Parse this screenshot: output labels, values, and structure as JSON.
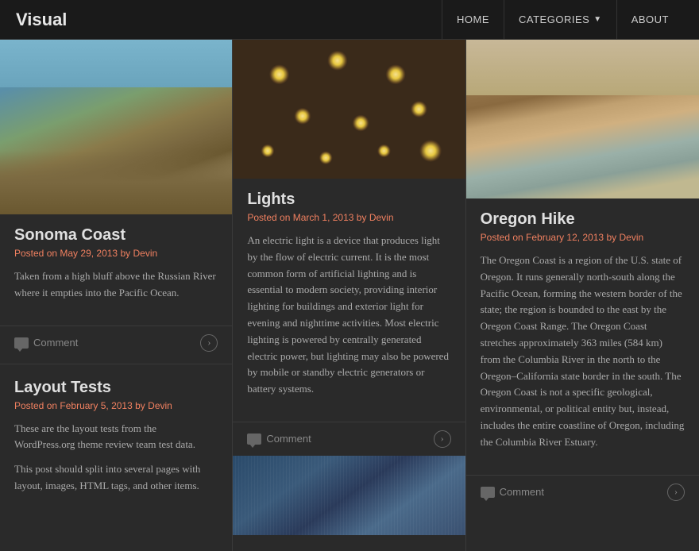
{
  "header": {
    "site_title": "Visual",
    "nav": {
      "home": "HOME",
      "categories": "CATEGORIES",
      "categories_chevron": "▼",
      "about": "ABOUT"
    }
  },
  "posts": {
    "col1": {
      "post1": {
        "title": "Sonoma Coast",
        "meta_prefix": "Posted on",
        "date": "May 29, 2013",
        "by": "by",
        "author": "Devin",
        "excerpt": "Taken from a high bluff above the Russian River where it empties into the Pacific Ocean.",
        "comment_label": "Comment"
      },
      "post2": {
        "title": "Layout Tests",
        "meta_prefix": "Posted on",
        "date": "February 5, 2013",
        "by": "by",
        "author": "Devin",
        "excerpt1": "These are the layout tests from the WordPress.org theme review team test data.",
        "excerpt2": "This post should split into several pages with layout, images, HTML tags, and other items."
      }
    },
    "col2": {
      "post1": {
        "title": "Lights",
        "meta_prefix": "Posted on",
        "date": "March 1, 2013",
        "by": "by",
        "author": "Devin",
        "excerpt": "An electric light is a device that produces light by the flow of electric current. It is the most common form of artificial lighting and is essential to modern society, providing interior lighting for buildings and exterior light for evening and nighttime activities. Most electric lighting is powered by centrally generated electric power, but lighting may also be powered by mobile or standby electric generators or battery systems.",
        "comment_label": "Comment"
      }
    },
    "col3": {
      "post1": {
        "title": "Oregon Hike",
        "meta_prefix": "Posted on",
        "date": "February 12, 2013",
        "by": "by",
        "author": "Devin",
        "excerpt": "The Oregon Coast is a region of the U.S. state of Oregon. It runs generally north-south along the Pacific Ocean, forming the western border of the state; the region is bounded to the east by the Oregon Coast Range. The Oregon Coast stretches approximately 363 miles (584 km) from the Columbia River in the north to the Oregon–California state border in the south. The Oregon Coast is not a specific geological, environmental, or political entity but, instead, includes the entire coastline of Oregon, including the Columbia River Estuary.",
        "comment_label": "Comment"
      }
    }
  }
}
